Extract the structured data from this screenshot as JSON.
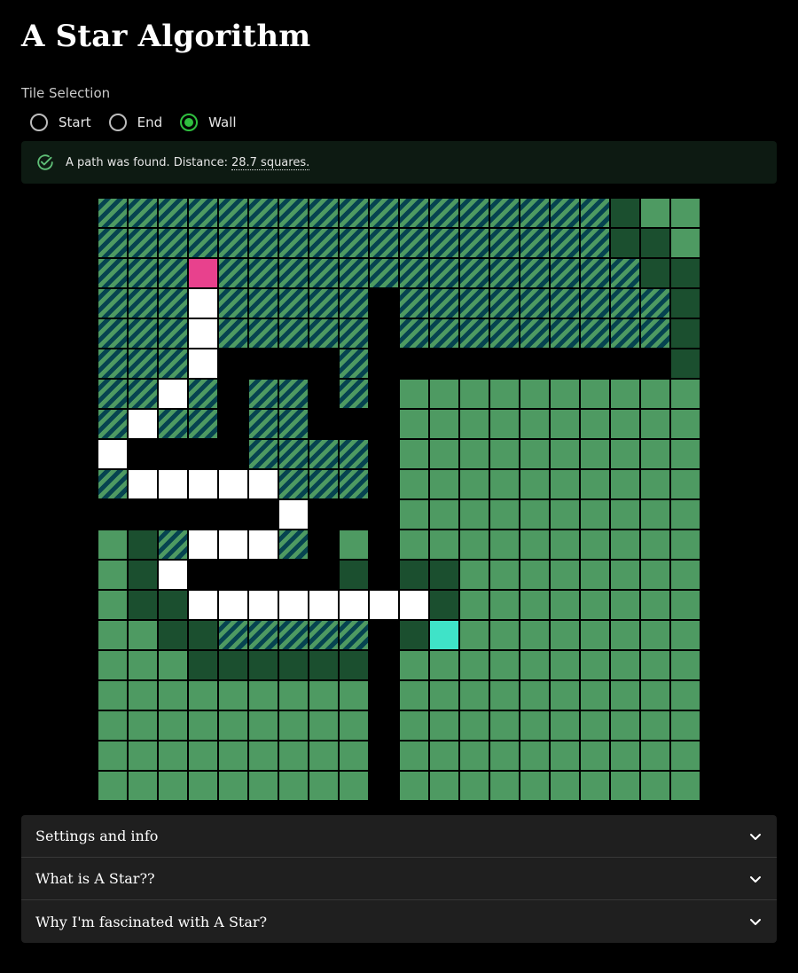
{
  "page": {
    "title": "A Star Algorithm"
  },
  "tile_selection": {
    "label": "Tile Selection",
    "options": [
      {
        "label": "Start",
        "checked": false
      },
      {
        "label": "End",
        "checked": false
      },
      {
        "label": "Wall",
        "checked": true
      }
    ]
  },
  "alert": {
    "icon": "check-circle-icon",
    "text": "A path was found. Distance:",
    "distance": "28.7 squares."
  },
  "grid": {
    "legend": {
      "V": "visited (striped)",
      "O": "open set (light green)",
      "C": "closed set (dark green)",
      "W": "wall",
      "P": "path",
      "S": "start",
      "E": "end"
    },
    "rows": [
      "VVVVVVVVVVVVVVVVVCOO",
      "VVVVVVVVVVVVVVVVVCCO",
      "VVVSVVVVVVVVVVVVVVCC",
      "VVVPVVVVVWVVVVVVVVVC",
      "VVVPVVVVVWVVVVVVVVVC",
      "VVVPWWWWVWWWWWWWWWWC",
      "VVPVWVVWVWOOOOOOOOOO",
      "VPVVWVVWWWOOOOOOOOOO",
      "PWWWWVVVVWOOOOOOOOOO",
      "VPPPPPVVVWOOOOOOOOOO",
      "WWWWWWPWWWOOOOOOOOOO",
      "OCVPPPVWOWOOOOOOOOOO",
      "OCPWWWWWCWCCOOOOOOOO",
      "OCCPPPPPPPPCOOOOOOOO",
      "OOCCVVVVVWCEOOOOOOOO",
      "OOOCCCCCCWOOOOOOOOOO",
      "OOOOOOOOOWOOOOOOOOOO",
      "OOOOOOOOOWOOOOOOOOOO",
      "OOOOOOOOOWOOOOOOOOOO",
      "OOOOOOOOOWOOOOOOOOOO"
    ]
  },
  "accordion": {
    "items": [
      {
        "label": "Settings and info",
        "icon": "chevron-down-icon"
      },
      {
        "label": "What is A Star??",
        "icon": "chevron-down-icon"
      },
      {
        "label": "Why I'm fascinated with A Star?",
        "icon": "chevron-down-icon"
      }
    ]
  },
  "colors": {
    "open": "#4e9a62",
    "closed": "#1b4f2f",
    "stripe": "#064350",
    "start": "#e8418d",
    "end": "#3fe3c8",
    "path": "#ffffff",
    "radio_checked": "#2fbf3f"
  }
}
